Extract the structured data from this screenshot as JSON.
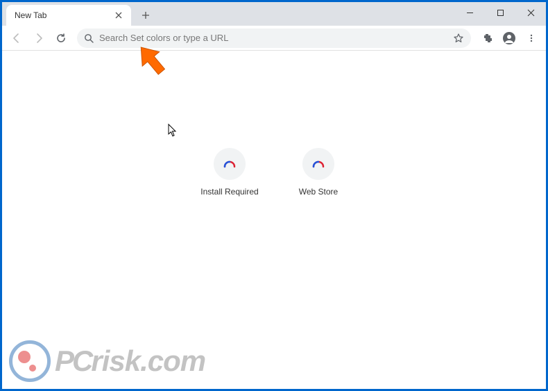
{
  "window": {
    "tab_title": "New Tab"
  },
  "toolbar": {
    "address_placeholder": "Search Set colors or type a URL"
  },
  "shortcuts": [
    {
      "label": "Install Required"
    },
    {
      "label": "Web Store"
    }
  ],
  "watermark": {
    "text_pc": "PC",
    "text_rest": "risk.com"
  }
}
